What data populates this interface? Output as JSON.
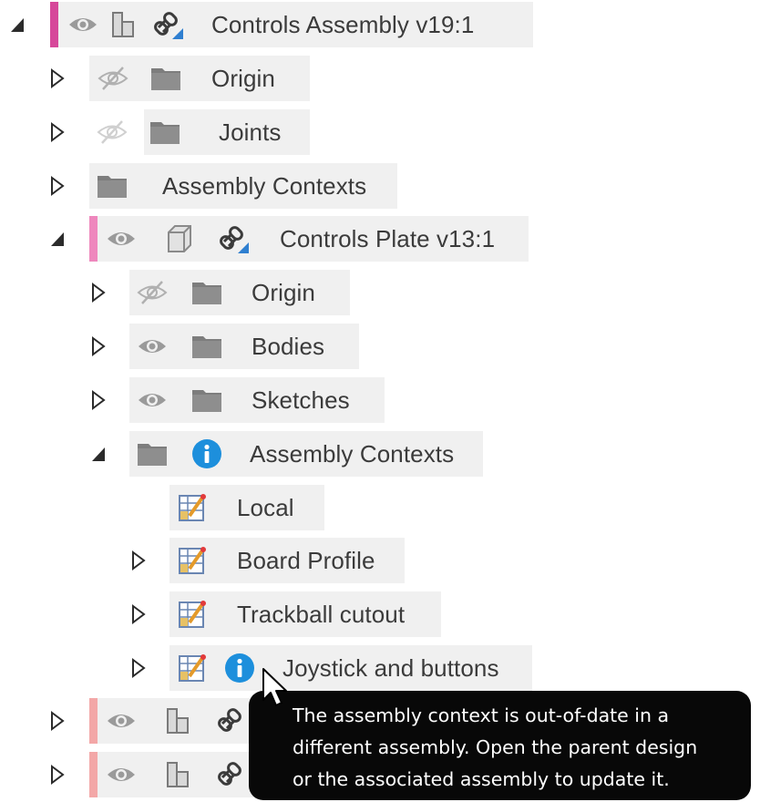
{
  "browser_tree": {
    "root": {
      "label": "Controls Assembly v19:1",
      "color": "#d6489a",
      "children": {
        "origin": {
          "label": "Origin"
        },
        "joints": {
          "label": "Joints"
        },
        "assembly_contexts": {
          "label": "Assembly Contexts"
        },
        "controls_plate": {
          "label": "Controls Plate v13:1",
          "color": "#ee87bd",
          "children": {
            "origin": {
              "label": "Origin"
            },
            "bodies": {
              "label": "Bodies"
            },
            "sketches": {
              "label": "Sketches"
            },
            "assembly_contexts": {
              "label": "Assembly Contexts",
              "info_icon": "info-icon",
              "items": [
                {
                  "label": "Local"
                },
                {
                  "label": "Board Profile"
                },
                {
                  "label": "Trackball cutout"
                },
                {
                  "label": "Joystick and buttons",
                  "status_icon": "info-icon"
                }
              ]
            }
          }
        },
        "extra_components_color": "#f3a7a7"
      }
    }
  },
  "tooltip": {
    "lines": [
      "The assembly context is out-of-date in a",
      "different assembly.  Open the parent design",
      "or the associated assembly to update it."
    ]
  },
  "colors": {
    "row_background": "#f0f0f0",
    "info_blue": "#1d8fdc",
    "tooltip_background": "#080808"
  }
}
